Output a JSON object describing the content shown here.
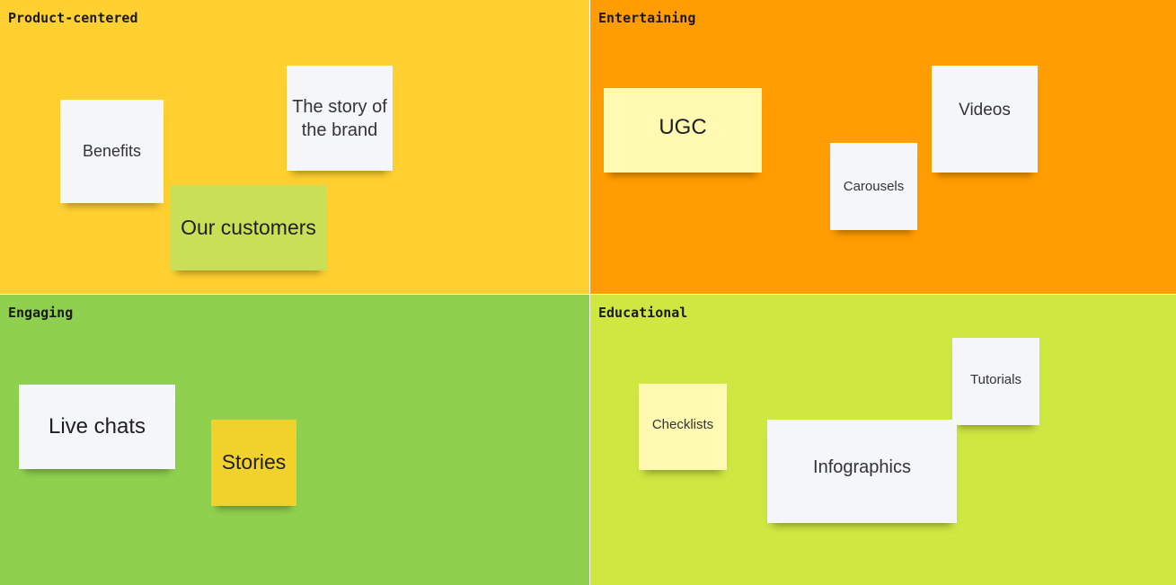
{
  "quadrants": [
    {
      "title": "Product-centered",
      "color": "#FFD02F"
    },
    {
      "title": "Entertaining",
      "color": "#FF9D02"
    },
    {
      "title": "Engaging",
      "color": "#8FD14F"
    },
    {
      "title": "Educational",
      "color": "#CEE741"
    }
  ],
  "notes": {
    "benefits": {
      "text": "Benefits",
      "color": "#F5F6F8"
    },
    "story": {
      "text": "The story of the brand",
      "color": "#F5F6F8"
    },
    "customers": {
      "text": "Our customers",
      "color": "#CADF58"
    },
    "ugc": {
      "text": "UGC",
      "color": "#FFF9B1"
    },
    "carousels": {
      "text": "Carousels",
      "color": "#F5F6F8"
    },
    "videos": {
      "text": "Videos",
      "color": "#F5F6F8"
    },
    "live_chats": {
      "text": "Live chats",
      "color": "#F5F6F8"
    },
    "stories": {
      "text": "Stories",
      "color": "#F1D22D"
    },
    "checklists": {
      "text": "Checklists",
      "color": "#FFF9B1"
    },
    "tutorials": {
      "text": "Tutorials",
      "color": "#F5F6F8"
    },
    "infographics": {
      "text": "Infographics",
      "color": "#F5F6F8"
    }
  }
}
